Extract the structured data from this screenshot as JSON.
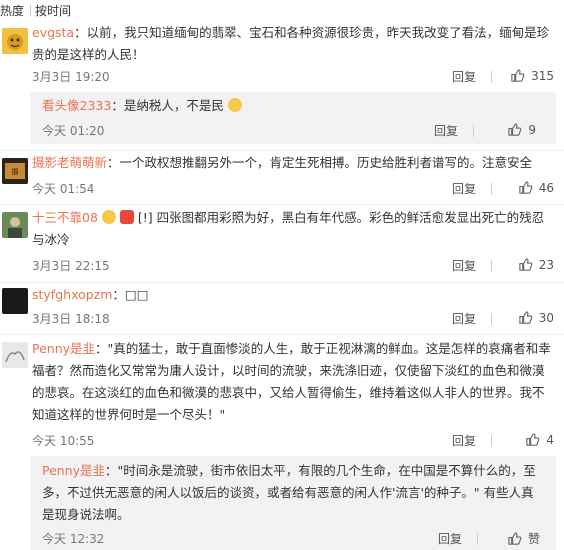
{
  "tabs": [
    "热度",
    "按时间"
  ],
  "comments": [
    {
      "user": "evgsta",
      "text": "：以前，我只知道缅甸的翡翠、宝石和各种资源很珍贵，昨天我改变了看法，缅甸是珍贵的是这样的人民！",
      "time": "3月3日 19:20",
      "reply": "回复",
      "likes": "315",
      "sub": {
        "user": "看头像2333",
        "text": "：是纳税人，不是民",
        "time": "今天 01:20",
        "reply": "回复",
        "likes": "9"
      }
    },
    {
      "user": "摄影老萌萌新",
      "text": "：一个政权想推翻另外一个，肯定生死相搏。历史给胜利者谱写的。注意安全",
      "time": "今天 01:54",
      "reply": "回复",
      "likes": "46"
    },
    {
      "user": "十三不靠08",
      "text": "[!] 四张图都用彩照为好，黑白有年代感。彩色的鲜活愈发显出死亡的残忍与冰冷",
      "time": "3月3日 22:15",
      "reply": "回复",
      "likes": "23"
    },
    {
      "user": "styfghxopzm",
      "text": "：□□",
      "time": "3月3日 18:18",
      "reply": "回复",
      "likes": "30"
    },
    {
      "user": "Penny是韭",
      "text": "：\"真的猛士，敢于直面惨淡的人生，敢于正视淋漓的鲜血。这是怎样的哀痛者和幸福者？然而造化又常常为庸人设计，以时间的流驶，来洗涤旧迹，仅使留下淡红的血色和微漠的悲哀。在这淡红的血色和微漠的悲哀中，又给人暂得偷生，维持着这似人非人的世界。我不知道这样的世界何时是一个尽头！\"",
      "time": "今天 10:55",
      "reply": "回复",
      "likes": "4",
      "sub": {
        "user": "Penny是韭",
        "text": "：\"时间永是流驶，街市依旧太平，有限的几个生命，在中国是不算什么的，至多，不过供无恶意的闲人以饭后的谈资，或者给有恶意的闲人作'流言'的种子。\" 有些人真是现身说法啊。",
        "time": "今天 12:32",
        "reply": "回复",
        "likes": "赞"
      }
    }
  ],
  "colors": {
    "username": "#eb7350",
    "text": "#333333",
    "meta": "#777777",
    "sub_bg": "#f2f2f5"
  }
}
